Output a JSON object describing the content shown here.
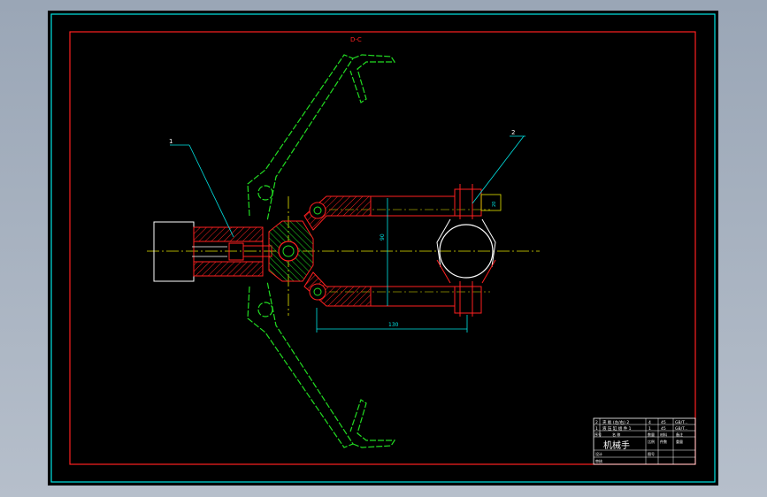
{
  "drawing": {
    "section_label": "D-C",
    "balloons": [
      "1",
      "2"
    ],
    "dim_vertical": "90",
    "dim_horizontal": "130",
    "dim_small": "20"
  },
  "title_block": {
    "title": "机械手",
    "rows": [
      [
        "2",
        "夹 板 (左/右) 2",
        "4",
        "45",
        "GB/T..."
      ],
      [
        "1",
        "液 压 缸 组 件 1",
        "1",
        "45",
        "GB/T..."
      ]
    ],
    "headers": [
      "序号",
      "名 称",
      "数量",
      "材料",
      "备注"
    ],
    "fields": [
      "比例",
      "件数",
      "重量",
      "图号",
      "设计",
      "审核"
    ]
  },
  "colors": {
    "red": "#ff2020",
    "green": "#22dd22",
    "cyan": "#00e5e5",
    "yellow": "#e6e600",
    "white": "#ffffff"
  }
}
